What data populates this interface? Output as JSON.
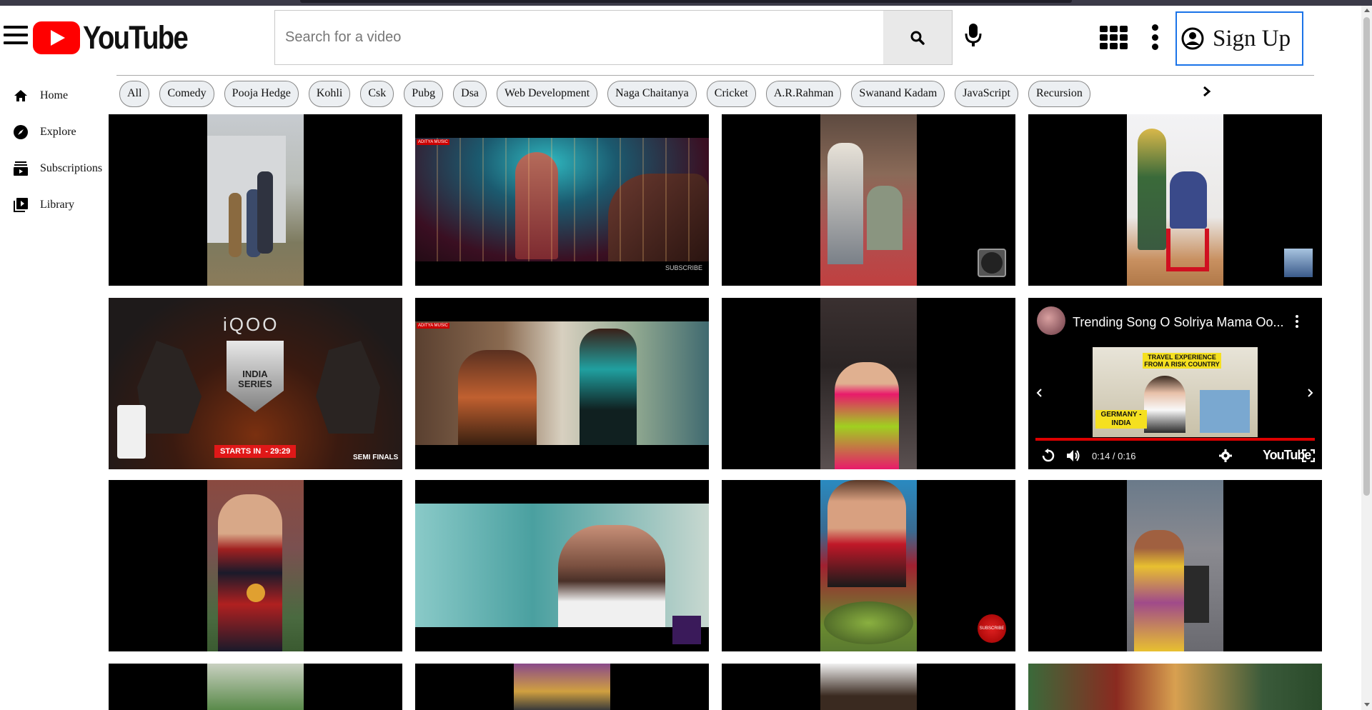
{
  "header": {
    "logo_text": "YouTube",
    "search_placeholder": "Search for a video",
    "signup_label": "Sign Up"
  },
  "sidebar": {
    "items": [
      {
        "label": "Home",
        "icon": "home-icon"
      },
      {
        "label": "Explore",
        "icon": "compass-icon"
      },
      {
        "label": "Subscriptions",
        "icon": "subscriptions-icon"
      },
      {
        "label": "Library",
        "icon": "library-icon"
      }
    ]
  },
  "chips": [
    "All",
    "Comedy",
    "Pooja Hedge",
    "Kohli",
    "Csk",
    "Pubg",
    "Dsa",
    "Web Development",
    "Naga Chaitanya",
    "Cricket",
    "A.R.Rahman",
    "Swanand Kadam",
    "JavaScript",
    "Recursion"
  ],
  "videos": {
    "v1": {},
    "v2": {
      "overlay_text": "SUBSCRIBE",
      "badge": "ADITYA MUSIC"
    },
    "v5": {
      "brand": "iQOO",
      "badge": "INDIA SERIES",
      "countdown": "STARTS IN  - 29:29",
      "stage": "SEMI FINALS"
    },
    "v6": {
      "badge": "ADITYA MUSIC"
    },
    "v8": {
      "title": "Trending Song O Solriya Mama Oo...",
      "time": "0:14 / 0:16",
      "brand": "YouTube",
      "inner_caption_1": "TRAVEL EXPERIENCE FROM A RISK COUNTRY",
      "inner_caption_2": "GERMANY - INDIA"
    },
    "v11": {
      "overlay_text": "SUBSCRIBE"
    }
  },
  "colors": {
    "brand_red": "#ff0000",
    "signup_border": "#1a73e8",
    "chip_bg": "#eceff2",
    "player_progress": "#dd0000"
  }
}
